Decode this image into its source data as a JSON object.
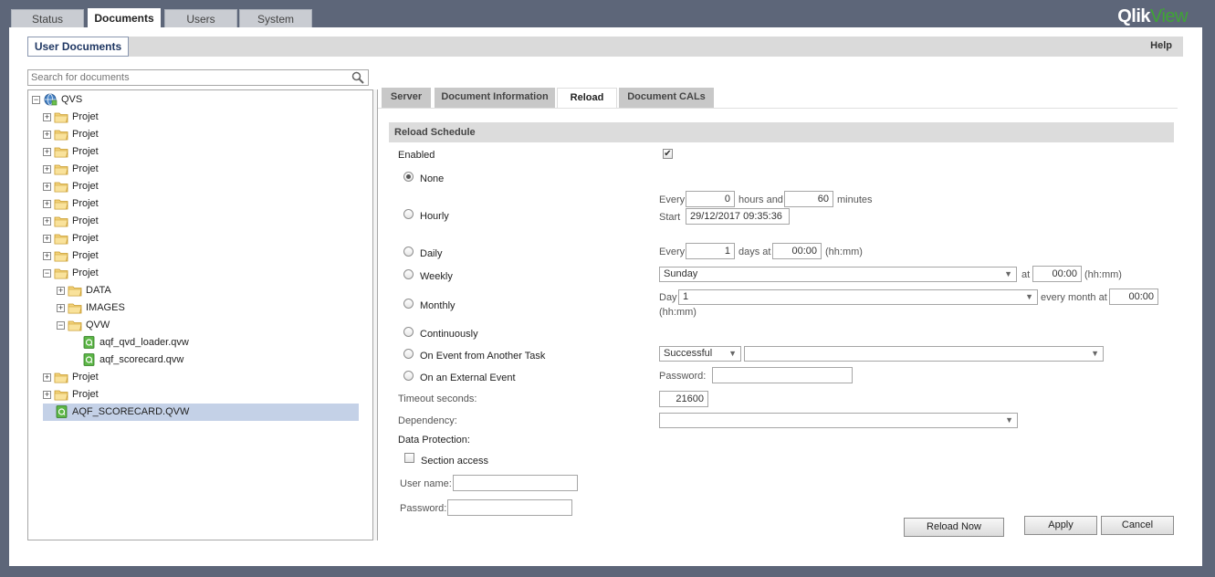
{
  "top_tabs": [
    {
      "label": "Status",
      "active": false
    },
    {
      "label": "Documents",
      "active": true
    },
    {
      "label": "Users",
      "active": false
    },
    {
      "label": "System",
      "active": false
    }
  ],
  "logo": {
    "qlik": "Qlik",
    "view": "View"
  },
  "subheader": {
    "tab": "User Documents",
    "help": "Help"
  },
  "search": {
    "placeholder": "Search for documents"
  },
  "tree": {
    "root": "QVS",
    "nodes": [
      {
        "label": "Projet",
        "level": 1,
        "type": "folder",
        "expander": "+"
      },
      {
        "label": "Projet",
        "level": 1,
        "type": "folder",
        "expander": "+"
      },
      {
        "label": "Projet",
        "level": 1,
        "type": "folder",
        "expander": "+"
      },
      {
        "label": "Projet",
        "level": 1,
        "type": "folder",
        "expander": "+"
      },
      {
        "label": "Projet",
        "level": 1,
        "type": "folder",
        "expander": "+"
      },
      {
        "label": "Projet",
        "level": 1,
        "type": "folder",
        "expander": "+"
      },
      {
        "label": "Projet",
        "level": 1,
        "type": "folder",
        "expander": "+"
      },
      {
        "label": "Projet",
        "level": 1,
        "type": "folder",
        "expander": "+"
      },
      {
        "label": "Projet",
        "level": 1,
        "type": "folder",
        "expander": "+"
      },
      {
        "label": "Projet",
        "level": 1,
        "type": "folder",
        "expander": "−"
      },
      {
        "label": "DATA",
        "level": 2,
        "type": "folder",
        "expander": "+"
      },
      {
        "label": "IMAGES",
        "level": 2,
        "type": "folder",
        "expander": "+"
      },
      {
        "label": "QVW",
        "level": 2,
        "type": "folder",
        "expander": "−"
      },
      {
        "label": "aqf_qvd_loader.qvw",
        "level": 3,
        "type": "doc",
        "expander": ""
      },
      {
        "label": "aqf_scorecard.qvw",
        "level": 3,
        "type": "doc",
        "expander": ""
      },
      {
        "label": "Projet",
        "level": 1,
        "type": "folder",
        "expander": "+"
      },
      {
        "label": "Projet",
        "level": 1,
        "type": "folder",
        "expander": "+"
      },
      {
        "label": "AQF_SCORECARD.QVW",
        "level": 1,
        "type": "doc",
        "expander": "",
        "selected": true
      }
    ]
  },
  "right_tabs": [
    {
      "label": "Server",
      "active": false
    },
    {
      "label": "Document Information",
      "active": false
    },
    {
      "label": "Reload",
      "active": true
    },
    {
      "label": "Document CALs",
      "active": false
    }
  ],
  "reload": {
    "section_title": "Reload Schedule",
    "enabled_label": "Enabled",
    "enabled_checked": true,
    "options": {
      "none": "None",
      "hourly": "Hourly",
      "daily": "Daily",
      "weekly": "Weekly",
      "monthly": "Monthly",
      "continuously": "Continuously",
      "event_task": "On Event from Another Task",
      "external": "On an External Event"
    },
    "selected_option": "none",
    "hourly": {
      "every_label": "Every",
      "hours_value": "0",
      "hours_and_label": "hours and",
      "minutes_value": "60",
      "minutes_label": "minutes",
      "start_label": "Start",
      "start_value": "29/12/2017 09:35:36"
    },
    "daily": {
      "every_label": "Every",
      "days_value": "1",
      "days_at_label": "days at",
      "time_value": "00:00",
      "format_label": "(hh:mm)"
    },
    "weekly": {
      "day_value": "Sunday",
      "at_label": "at",
      "time_value": "00:00",
      "format_label": "(hh:mm)"
    },
    "monthly": {
      "day_label": "Day",
      "day_value": "1",
      "every_month_label": "every month at",
      "time_value": "00:00",
      "format_label": "(hh:mm)"
    },
    "event_task": {
      "status_value": "Successful",
      "task_value": ""
    },
    "external": {
      "password_label": "Password:",
      "password_value": ""
    },
    "timeout_label": "Timeout seconds:",
    "timeout_value": "21600",
    "dependency_label": "Dependency:",
    "dependency_value": "",
    "data_protection_label": "Data Protection:",
    "section_access_label": "Section access",
    "user_name_label": "User name:",
    "user_name_value": "",
    "password_label": "Password:",
    "password_value": ""
  },
  "buttons": {
    "reload_now": "Reload Now",
    "apply": "Apply",
    "cancel": "Cancel"
  }
}
